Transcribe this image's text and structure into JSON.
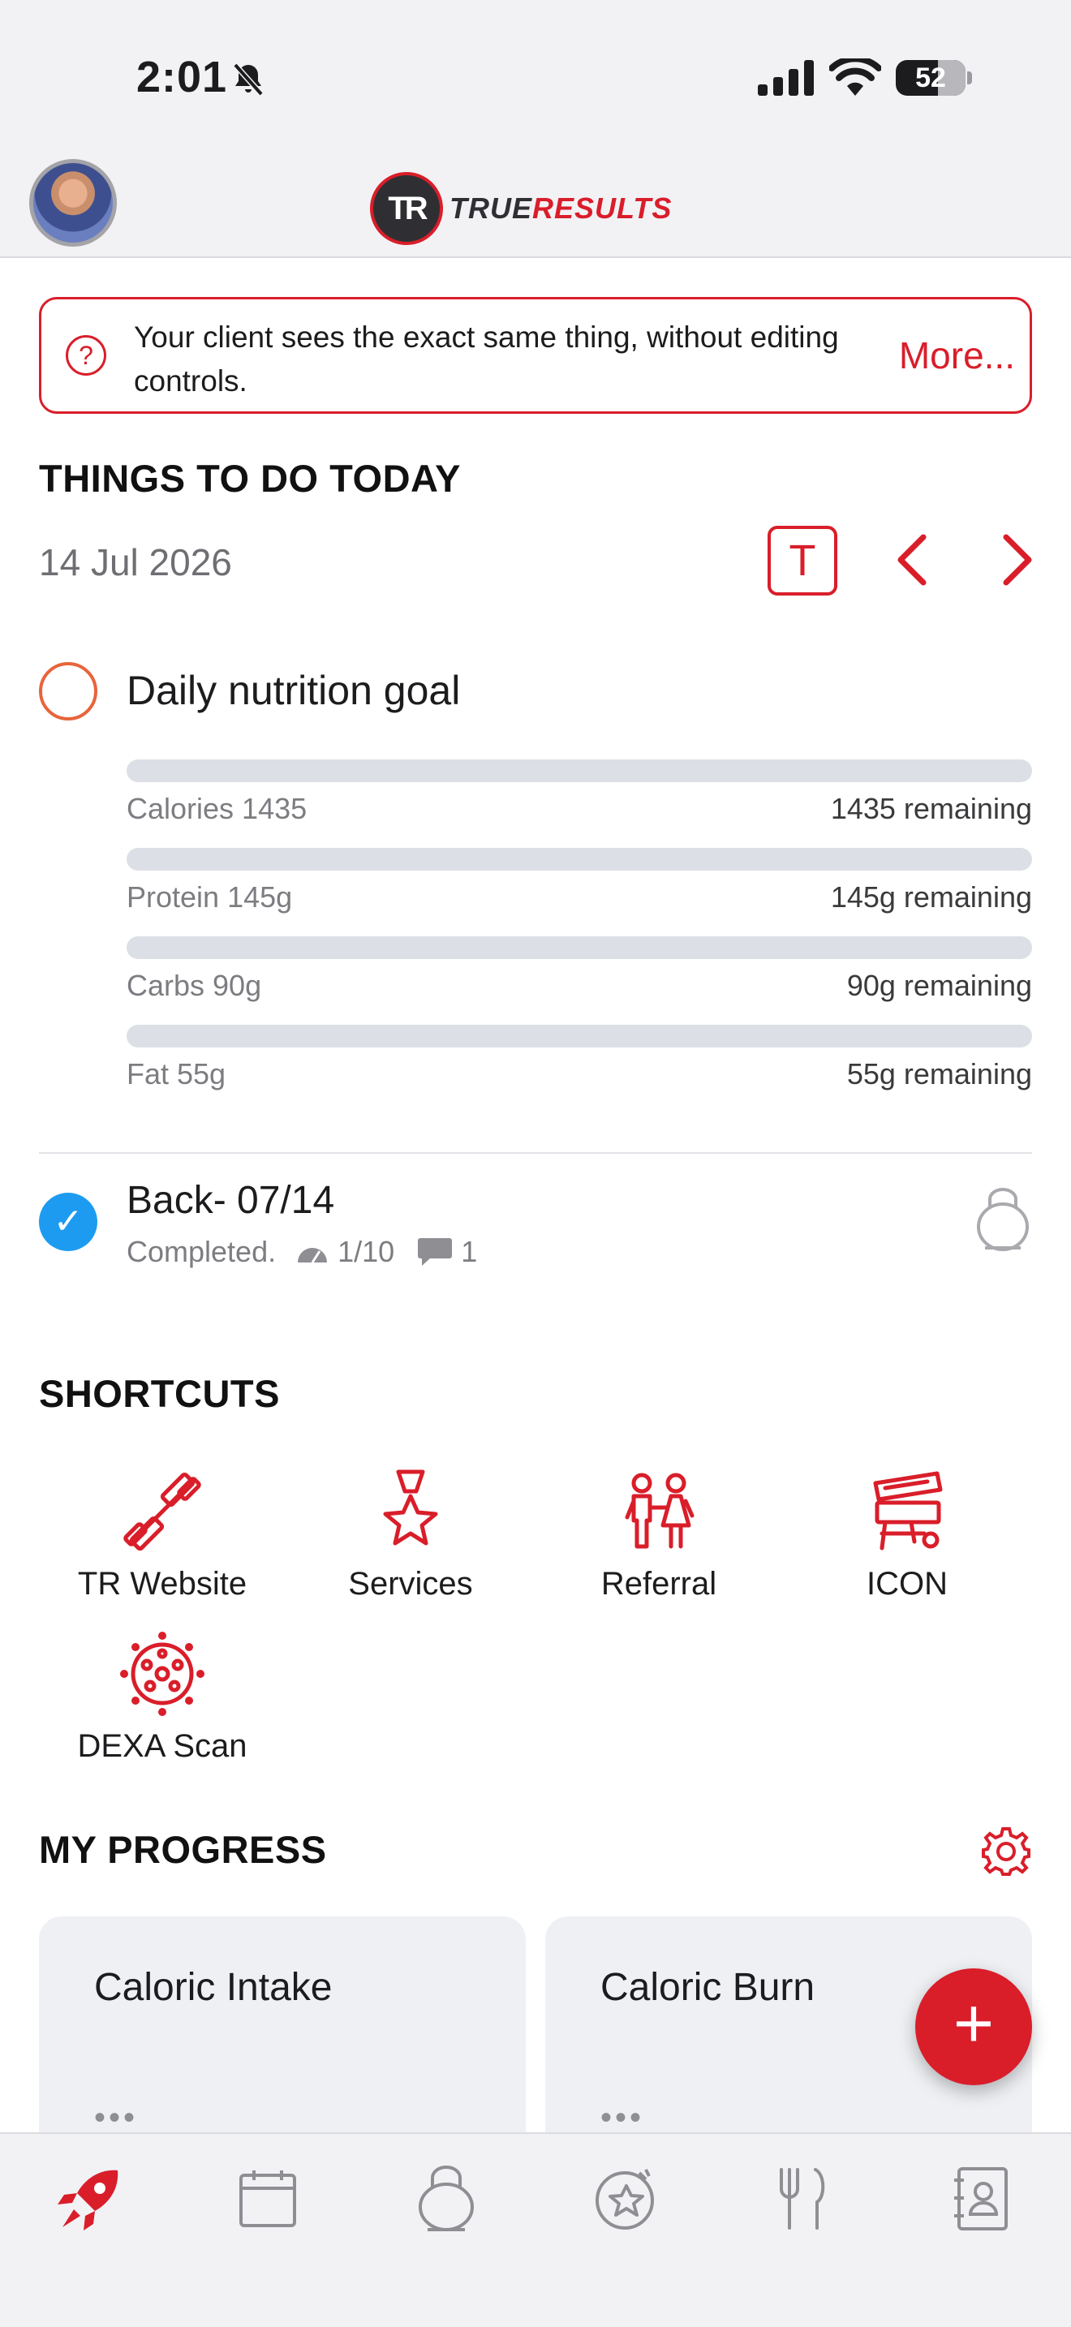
{
  "status_bar": {
    "time": "2:01",
    "battery": "52"
  },
  "header": {
    "logo_initials": "TR",
    "logo_text_part1": "TRUE",
    "logo_text_part2": "RESULTS"
  },
  "banner": {
    "message": "Your client sees the exact same thing, without editing controls.",
    "more_label": "More..."
  },
  "todo": {
    "title": "THINGS TO DO TODAY",
    "date": "14 Jul 2026",
    "today_button": "T",
    "prev_label": "‹",
    "next_label": "›",
    "nutrition_goal_title": "Daily nutrition goal",
    "nutrients": [
      {
        "label": "Calories 1435",
        "remaining": "1435 remaining",
        "progress": 0
      },
      {
        "label": "Protein 145g",
        "remaining": "145g remaining",
        "progress": 0
      },
      {
        "label": "Carbs 90g",
        "remaining": "90g remaining",
        "progress": 0
      },
      {
        "label": "Fat 55g",
        "remaining": "55g remaining",
        "progress": 0
      }
    ],
    "workout": {
      "title": "Back- 07/14",
      "status": "Completed.",
      "rpe": "1/10",
      "comments": "1"
    }
  },
  "shortcuts": {
    "title": "SHORTCUTS",
    "items": [
      {
        "label": "TR Website",
        "icon": "barbell-icon"
      },
      {
        "label": "Services",
        "icon": "medal-star-icon"
      },
      {
        "label": "Referral",
        "icon": "kids-icon"
      },
      {
        "label": "ICON",
        "icon": "grill-icon"
      },
      {
        "label": "DEXA Scan",
        "icon": "virus-icon"
      }
    ]
  },
  "progress": {
    "title": "MY PROGRESS",
    "cards": [
      {
        "title": "Caloric Intake",
        "dots": "•••"
      },
      {
        "title": "Caloric Burn",
        "dots": "•••"
      }
    ]
  },
  "fab_label": "+",
  "colors": {
    "accent": "#d91e2a",
    "check_blue": "#1d9bf0",
    "goal_orange": "#e8643c"
  },
  "tabs": [
    "rocket-icon",
    "calendar-icon",
    "kettlebell-icon",
    "badge-star-icon",
    "utensils-icon",
    "contacts-icon"
  ]
}
